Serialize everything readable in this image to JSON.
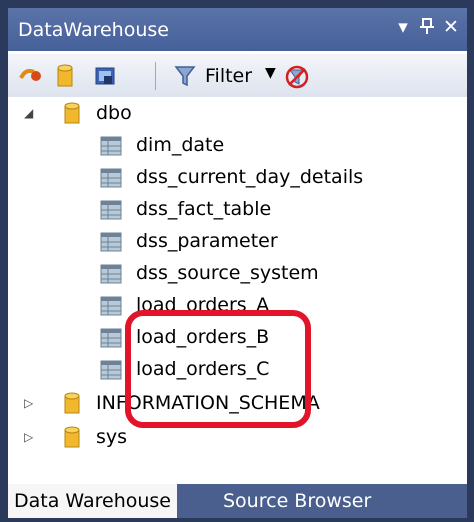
{
  "window": {
    "title": "DataWarehouse",
    "dropdown_glyph": "▾",
    "pin_glyph": "ꟸ",
    "close_glyph": "✕"
  },
  "toolbar": {
    "filter_label": "Filter",
    "filter_caret": "▼"
  },
  "tree": {
    "schemas": [
      {
        "name": "dbo",
        "expanded": true,
        "tables": [
          "dim_date",
          "dss_current_day_details",
          "dss_fact_table",
          "dss_parameter",
          "dss_source_system",
          "load_orders_A",
          "load_orders_B",
          "load_orders_C"
        ]
      },
      {
        "name": "INFORMATION_SCHEMA",
        "expanded": false
      },
      {
        "name": "sys",
        "expanded": false
      }
    ]
  },
  "tabs": [
    {
      "label": "Data Warehouse",
      "active": true
    },
    {
      "label": "Source Browser",
      "active": false
    }
  ],
  "colors": {
    "title_bar": "#4f68a0",
    "highlight": "#e2142a",
    "tab_strip": "#4a5f8e"
  }
}
